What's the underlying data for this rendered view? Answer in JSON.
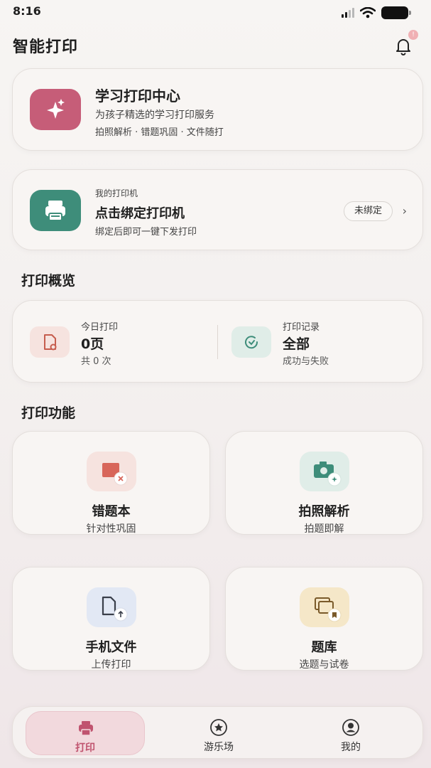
{
  "status_bar": {
    "time": "8:16"
  },
  "header": {
    "title": "智能打印",
    "notification_count": "!"
  },
  "hero": {
    "title": "学习打印中心",
    "subtitle": "为孩子精选的学习打印服务",
    "tags": "拍照解析 · 错题巩固 · 文件随打",
    "icon": "sparkle-icon",
    "color": "#c65d78"
  },
  "printer": {
    "kicker": "我的打印机",
    "title": "点击绑定打印机",
    "subtitle": "绑定后即可一键下发打印",
    "badge": "未绑定",
    "chevron": "›",
    "icon": "printer-icon",
    "color": "#3e8d7a"
  },
  "overview": {
    "section_title": "打印概览",
    "today": {
      "label": "今日打印",
      "value": "0页",
      "sub": "共 0 次",
      "icon": "document-icon"
    },
    "records": {
      "label": "打印记录",
      "value": "全部",
      "sub": "成功与失败",
      "icon": "history-icon"
    }
  },
  "features": {
    "section_title": "打印功能",
    "items": [
      {
        "title": "错题本",
        "subtitle": "针对性巩固",
        "icon": "wrong-book-icon"
      },
      {
        "title": "拍照解析",
        "subtitle": "拍题即解",
        "icon": "camera-icon"
      },
      {
        "title": "手机文件",
        "subtitle": "上传打印",
        "icon": "upload-file-icon"
      },
      {
        "title": "题库",
        "subtitle": "选题与试卷",
        "icon": "question-bank-icon"
      }
    ]
  },
  "tabbar": {
    "items": [
      {
        "label": "打印",
        "icon": "printer-icon",
        "active": true
      },
      {
        "label": "游乐场",
        "icon": "star-circle-icon",
        "active": false
      },
      {
        "label": "我的",
        "icon": "user-icon",
        "active": false
      }
    ]
  }
}
